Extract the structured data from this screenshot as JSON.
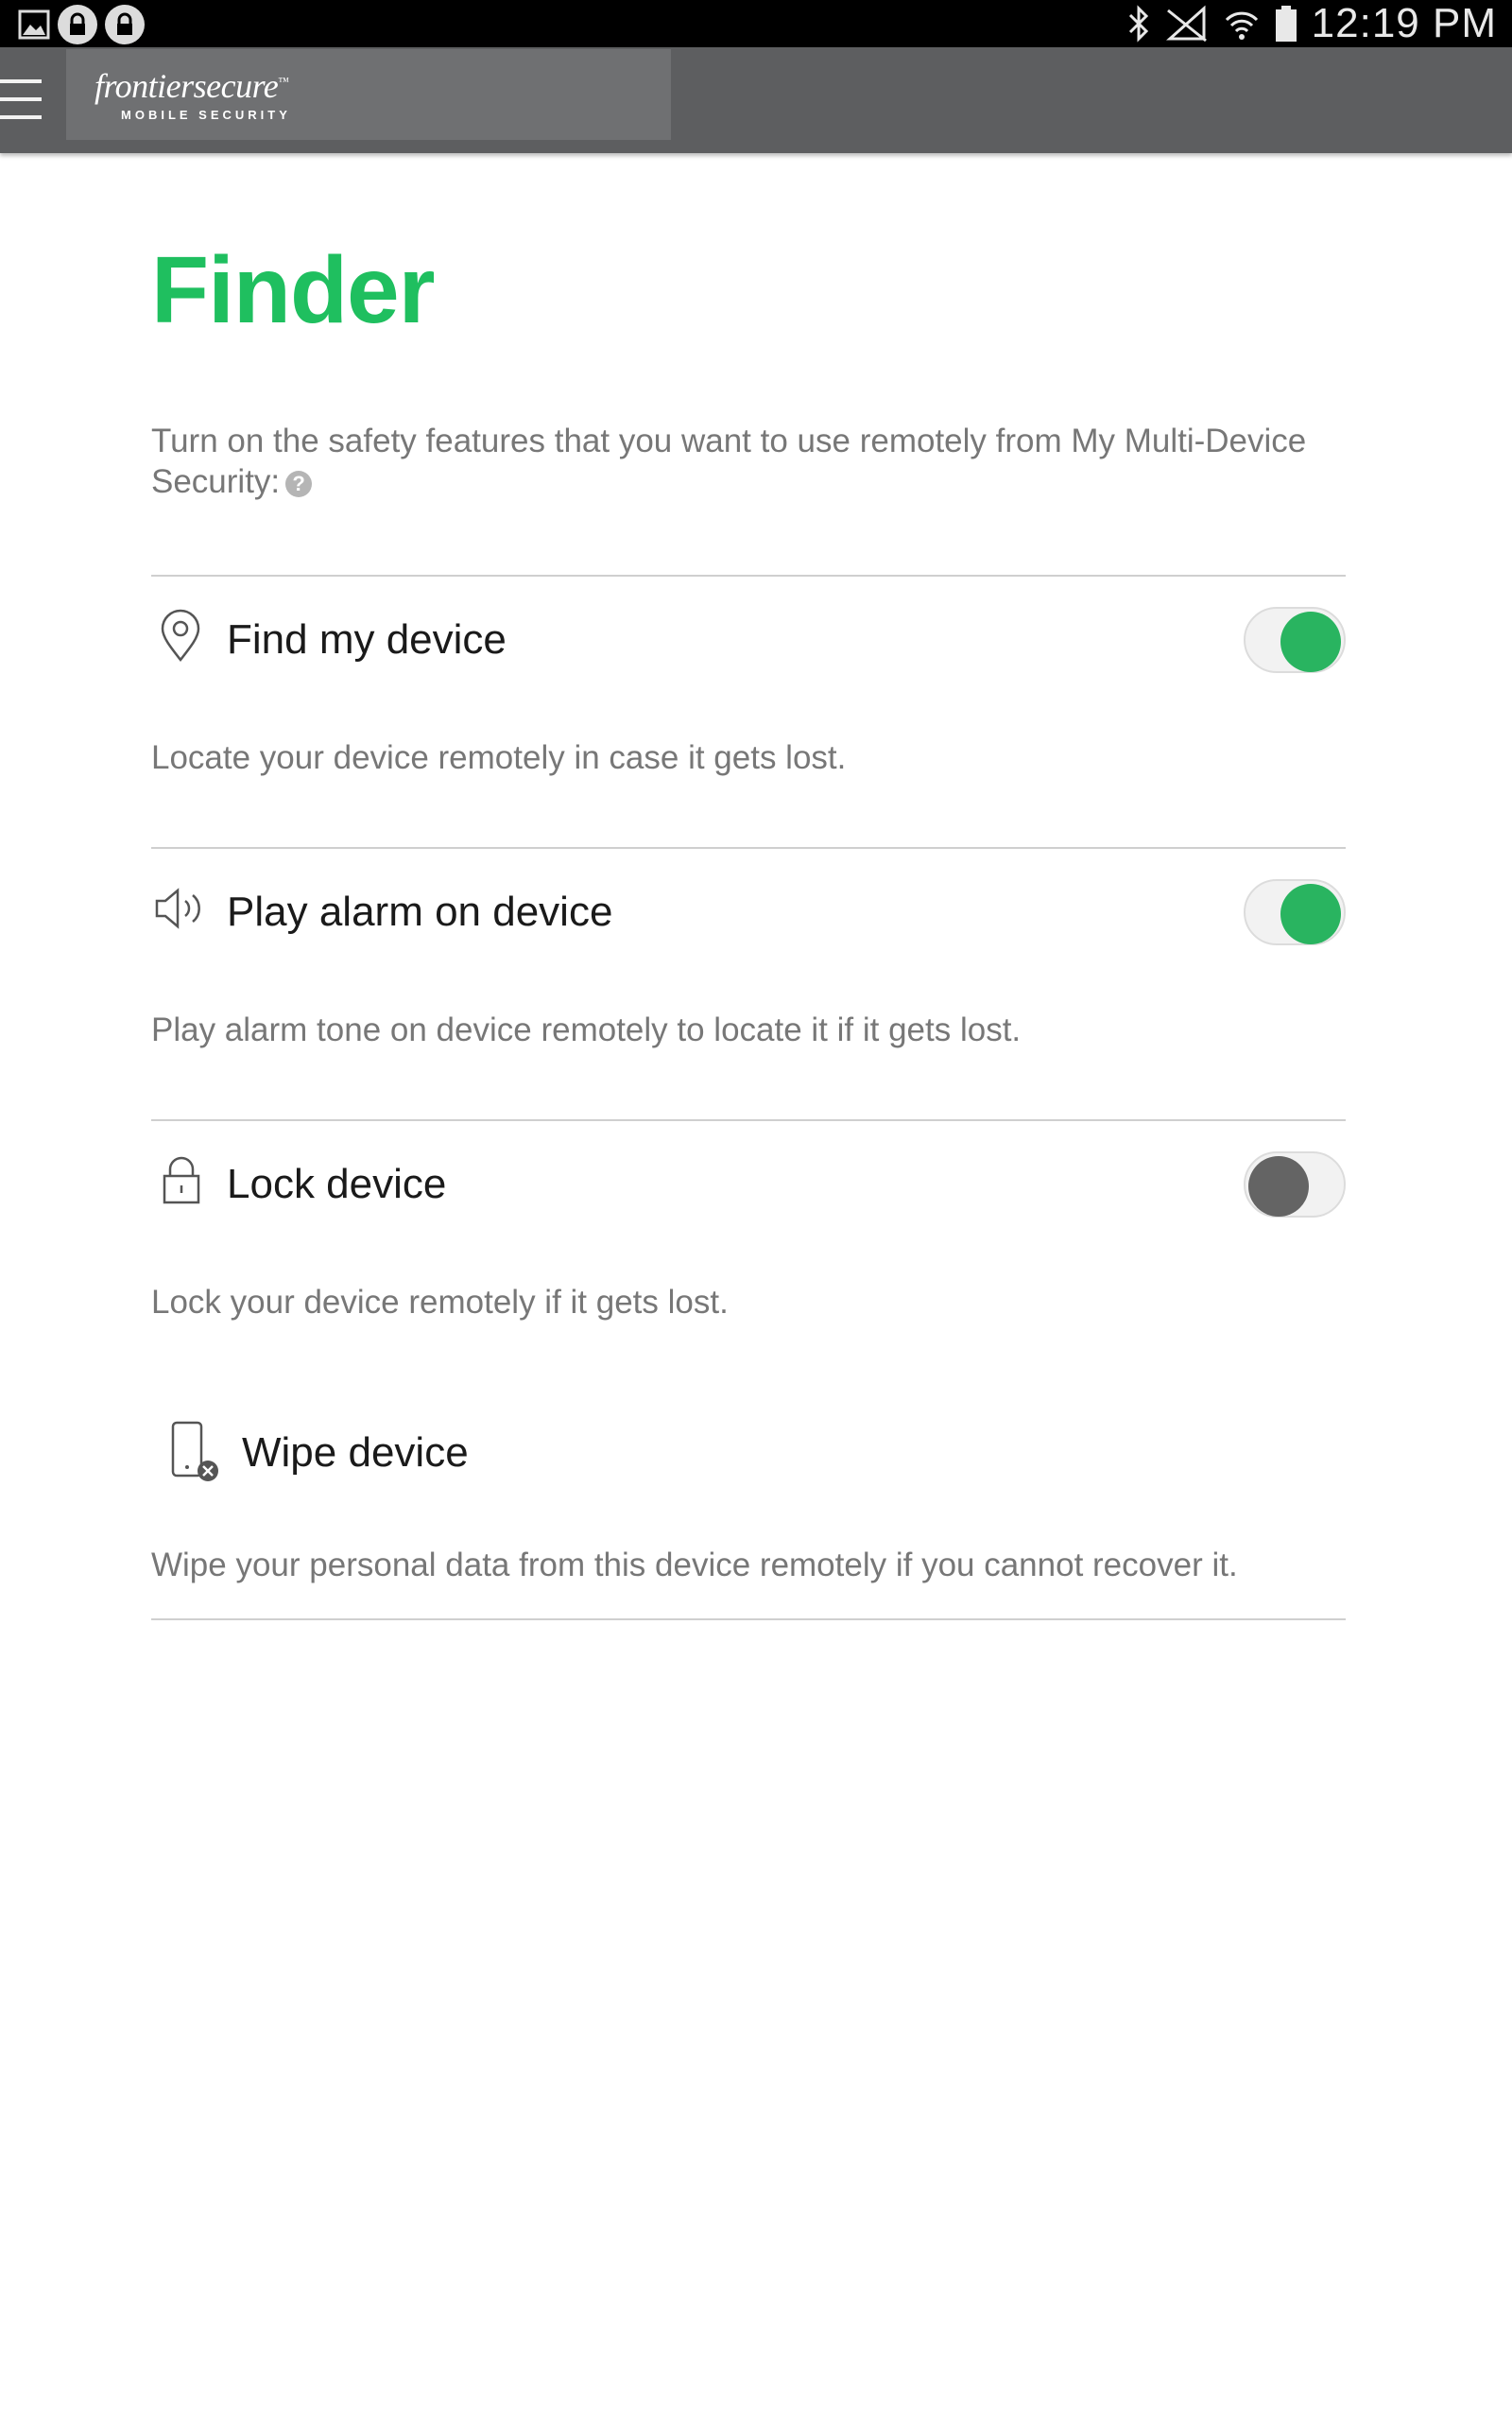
{
  "status_bar": {
    "time": "12:19 PM",
    "left_icons": [
      "gallery-icon",
      "lock-notification-icon",
      "lock-notification-icon"
    ],
    "right_icons": [
      "bluetooth-icon",
      "no-signal-icon",
      "wifi-icon",
      "battery-icon"
    ]
  },
  "app_bar": {
    "brand_name": "frontiersecure",
    "brand_trademark": "™",
    "brand_subtitle": "MOBILE SECURITY",
    "menu_icon": "hamburger-menu-icon",
    "background": "#5d5e60"
  },
  "page": {
    "title": "Finder",
    "title_color": "#1fbf5f",
    "intro": "Turn on the safety features that you want to use remotely from My Multi-Device Security:"
  },
  "features": [
    {
      "title": "Find my device",
      "description": "Locate your device remotely in case it gets lost.",
      "icon": "location-pin-icon",
      "enabled": true
    },
    {
      "title": "Play alarm on device",
      "description": "Play alarm tone on device remotely to locate it if it gets lost.",
      "icon": "speaker-icon",
      "enabled": true
    },
    {
      "title": "Lock device",
      "description": "Lock your device remotely if it gets lost.",
      "icon": "padlock-icon",
      "enabled": false
    },
    {
      "title": "Wipe device",
      "description": "Wipe your personal data from this device remotely if you cannot recover it.",
      "icon": "phone-wipe-icon"
    }
  ],
  "colors": {
    "toggle_on": "#29b460",
    "toggle_off": "#646464"
  }
}
